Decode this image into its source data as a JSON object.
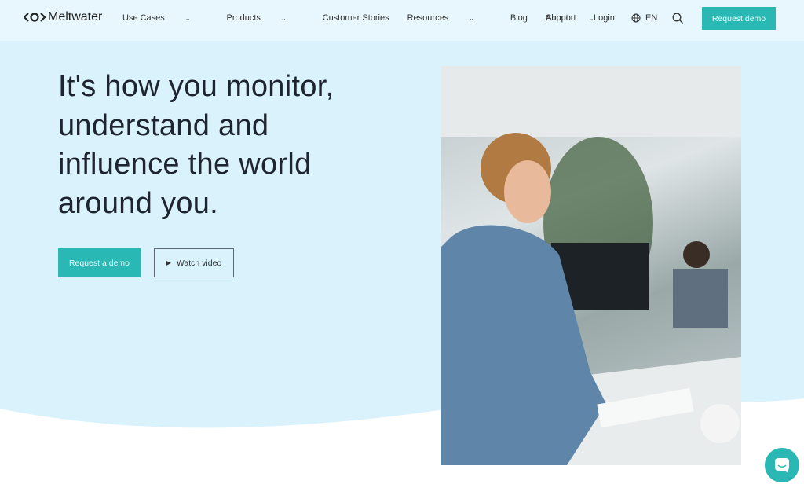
{
  "header": {
    "logo": "Meltwater",
    "nav": [
      {
        "label": "Use Cases",
        "dropdown": true
      },
      {
        "label": "Products",
        "dropdown": true
      },
      {
        "label": "Customer Stories",
        "dropdown": false
      },
      {
        "label": "Resources",
        "dropdown": true
      },
      {
        "label": "Blog",
        "dropdown": false
      },
      {
        "label": "About",
        "dropdown": true
      }
    ],
    "support": "Support",
    "login": "Login",
    "language": "EN",
    "cta": "Request demo"
  },
  "hero": {
    "lines": [
      "It's how you monitor,",
      "understand and",
      "influence the world",
      "around you."
    ],
    "primary": "Request a demo",
    "secondary": "Watch video"
  },
  "colors": {
    "accent": "#2ab8b4",
    "hero_bg": "#d9f2fc"
  }
}
